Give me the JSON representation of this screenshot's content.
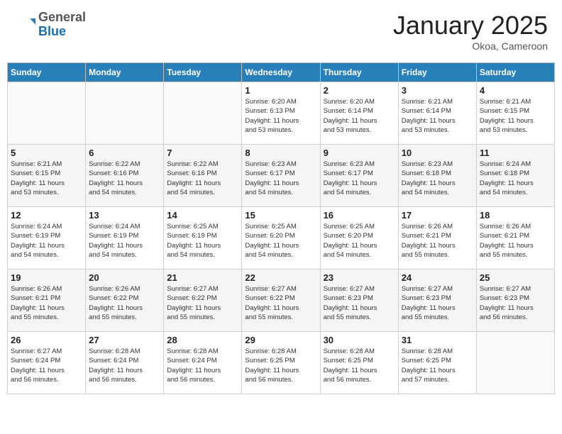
{
  "header": {
    "logo_general": "General",
    "logo_blue": "Blue",
    "month_title": "January 2025",
    "location": "Okoa, Cameroon"
  },
  "weekdays": [
    "Sunday",
    "Monday",
    "Tuesday",
    "Wednesday",
    "Thursday",
    "Friday",
    "Saturday"
  ],
  "weeks": [
    [
      {
        "day": "",
        "info": ""
      },
      {
        "day": "",
        "info": ""
      },
      {
        "day": "",
        "info": ""
      },
      {
        "day": "1",
        "info": "Sunrise: 6:20 AM\nSunset: 6:13 PM\nDaylight: 11 hours\nand 53 minutes."
      },
      {
        "day": "2",
        "info": "Sunrise: 6:20 AM\nSunset: 6:14 PM\nDaylight: 11 hours\nand 53 minutes."
      },
      {
        "day": "3",
        "info": "Sunrise: 6:21 AM\nSunset: 6:14 PM\nDaylight: 11 hours\nand 53 minutes."
      },
      {
        "day": "4",
        "info": "Sunrise: 6:21 AM\nSunset: 6:15 PM\nDaylight: 11 hours\nand 53 minutes."
      }
    ],
    [
      {
        "day": "5",
        "info": "Sunrise: 6:21 AM\nSunset: 6:15 PM\nDaylight: 11 hours\nand 53 minutes."
      },
      {
        "day": "6",
        "info": "Sunrise: 6:22 AM\nSunset: 6:16 PM\nDaylight: 11 hours\nand 54 minutes."
      },
      {
        "day": "7",
        "info": "Sunrise: 6:22 AM\nSunset: 6:16 PM\nDaylight: 11 hours\nand 54 minutes."
      },
      {
        "day": "8",
        "info": "Sunrise: 6:23 AM\nSunset: 6:17 PM\nDaylight: 11 hours\nand 54 minutes."
      },
      {
        "day": "9",
        "info": "Sunrise: 6:23 AM\nSunset: 6:17 PM\nDaylight: 11 hours\nand 54 minutes."
      },
      {
        "day": "10",
        "info": "Sunrise: 6:23 AM\nSunset: 6:18 PM\nDaylight: 11 hours\nand 54 minutes."
      },
      {
        "day": "11",
        "info": "Sunrise: 6:24 AM\nSunset: 6:18 PM\nDaylight: 11 hours\nand 54 minutes."
      }
    ],
    [
      {
        "day": "12",
        "info": "Sunrise: 6:24 AM\nSunset: 6:19 PM\nDaylight: 11 hours\nand 54 minutes."
      },
      {
        "day": "13",
        "info": "Sunrise: 6:24 AM\nSunset: 6:19 PM\nDaylight: 11 hours\nand 54 minutes."
      },
      {
        "day": "14",
        "info": "Sunrise: 6:25 AM\nSunset: 6:19 PM\nDaylight: 11 hours\nand 54 minutes."
      },
      {
        "day": "15",
        "info": "Sunrise: 6:25 AM\nSunset: 6:20 PM\nDaylight: 11 hours\nand 54 minutes."
      },
      {
        "day": "16",
        "info": "Sunrise: 6:25 AM\nSunset: 6:20 PM\nDaylight: 11 hours\nand 54 minutes."
      },
      {
        "day": "17",
        "info": "Sunrise: 6:26 AM\nSunset: 6:21 PM\nDaylight: 11 hours\nand 55 minutes."
      },
      {
        "day": "18",
        "info": "Sunrise: 6:26 AM\nSunset: 6:21 PM\nDaylight: 11 hours\nand 55 minutes."
      }
    ],
    [
      {
        "day": "19",
        "info": "Sunrise: 6:26 AM\nSunset: 6:21 PM\nDaylight: 11 hours\nand 55 minutes."
      },
      {
        "day": "20",
        "info": "Sunrise: 6:26 AM\nSunset: 6:22 PM\nDaylight: 11 hours\nand 55 minutes."
      },
      {
        "day": "21",
        "info": "Sunrise: 6:27 AM\nSunset: 6:22 PM\nDaylight: 11 hours\nand 55 minutes."
      },
      {
        "day": "22",
        "info": "Sunrise: 6:27 AM\nSunset: 6:22 PM\nDaylight: 11 hours\nand 55 minutes."
      },
      {
        "day": "23",
        "info": "Sunrise: 6:27 AM\nSunset: 6:23 PM\nDaylight: 11 hours\nand 55 minutes."
      },
      {
        "day": "24",
        "info": "Sunrise: 6:27 AM\nSunset: 6:23 PM\nDaylight: 11 hours\nand 55 minutes."
      },
      {
        "day": "25",
        "info": "Sunrise: 6:27 AM\nSunset: 6:23 PM\nDaylight: 11 hours\nand 56 minutes."
      }
    ],
    [
      {
        "day": "26",
        "info": "Sunrise: 6:27 AM\nSunset: 6:24 PM\nDaylight: 11 hours\nand 56 minutes."
      },
      {
        "day": "27",
        "info": "Sunrise: 6:28 AM\nSunset: 6:24 PM\nDaylight: 11 hours\nand 56 minutes."
      },
      {
        "day": "28",
        "info": "Sunrise: 6:28 AM\nSunset: 6:24 PM\nDaylight: 11 hours\nand 56 minutes."
      },
      {
        "day": "29",
        "info": "Sunrise: 6:28 AM\nSunset: 6:25 PM\nDaylight: 11 hours\nand 56 minutes."
      },
      {
        "day": "30",
        "info": "Sunrise: 6:28 AM\nSunset: 6:25 PM\nDaylight: 11 hours\nand 56 minutes."
      },
      {
        "day": "31",
        "info": "Sunrise: 6:28 AM\nSunset: 6:25 PM\nDaylight: 11 hours\nand 57 minutes."
      },
      {
        "day": "",
        "info": ""
      }
    ]
  ]
}
